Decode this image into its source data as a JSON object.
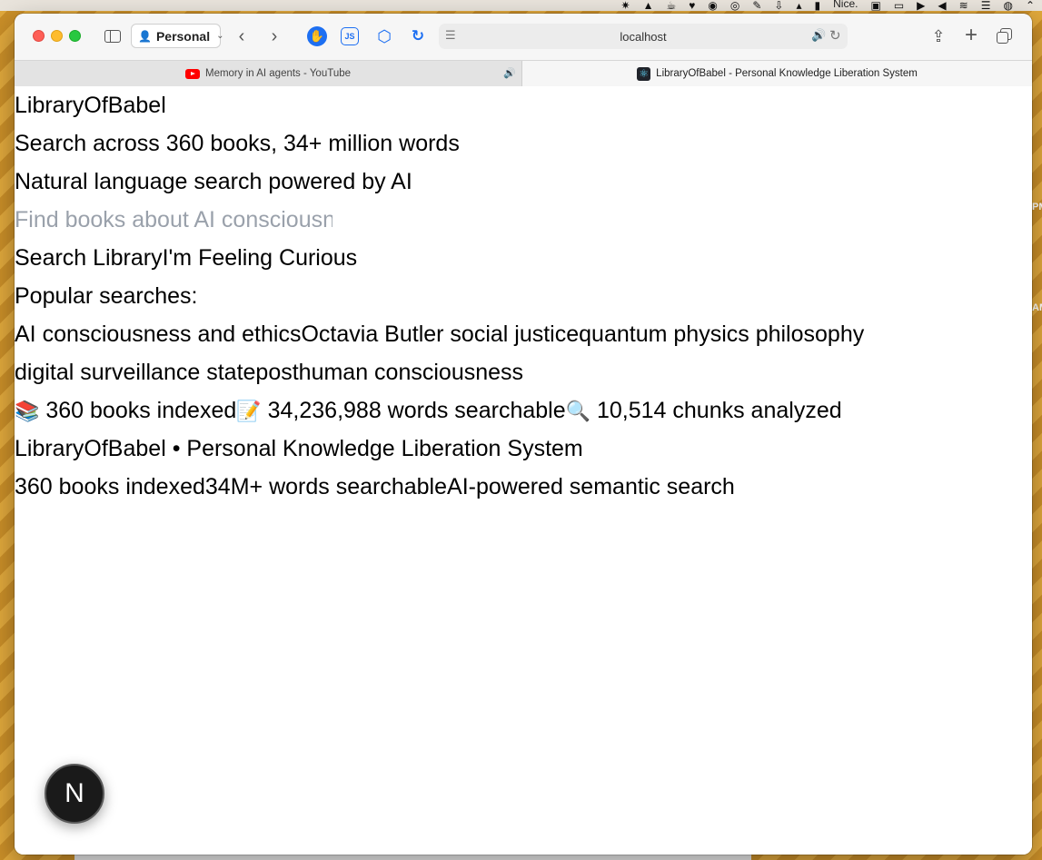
{
  "menubar": {
    "status_text": "Nice."
  },
  "desktop": {
    "side_labels": [
      "PM",
      "AM"
    ]
  },
  "browser": {
    "profile_label": "Personal",
    "url": "localhost",
    "extensions": {
      "js_label": "JS"
    },
    "tabs": [
      {
        "title": "Memory in AI agents - YouTube",
        "icon": "youtube-icon",
        "active": false,
        "audio": true
      },
      {
        "title": "LibraryOfBabel - Personal Knowledge Liberation System",
        "icon": "react-icon",
        "active": true
      }
    ]
  },
  "page": {
    "app_title": "LibraryOfBabel",
    "subtitle": "Search across 360 books, 34+ million words",
    "tagline": "Natural language search powered by AI",
    "search": {
      "placeholder": "Find books about AI consciousness",
      "value": ""
    },
    "buttons": {
      "search": "Search Library",
      "curious": "I'm Feeling Curious"
    },
    "popular_label": "Popular searches:",
    "popular_searches": [
      "AI consciousness and ethics",
      "Octavia Butler social justice",
      "quantum physics philosophy",
      "digital surveillance state",
      "posthuman consciousness"
    ],
    "stats": [
      {
        "icon": "📚",
        "text": "360 books indexed"
      },
      {
        "icon": "📝",
        "text": "34,236,988 words searchable"
      },
      {
        "icon": "🔍",
        "text": "10,514 chunks analyzed"
      }
    ],
    "footer_title": "LibraryOfBabel • Personal Knowledge Liberation System",
    "footer_items": [
      "360 books indexed",
      "34M+ words searchable",
      "AI-powered semantic search"
    ],
    "dev_badge": "N"
  }
}
